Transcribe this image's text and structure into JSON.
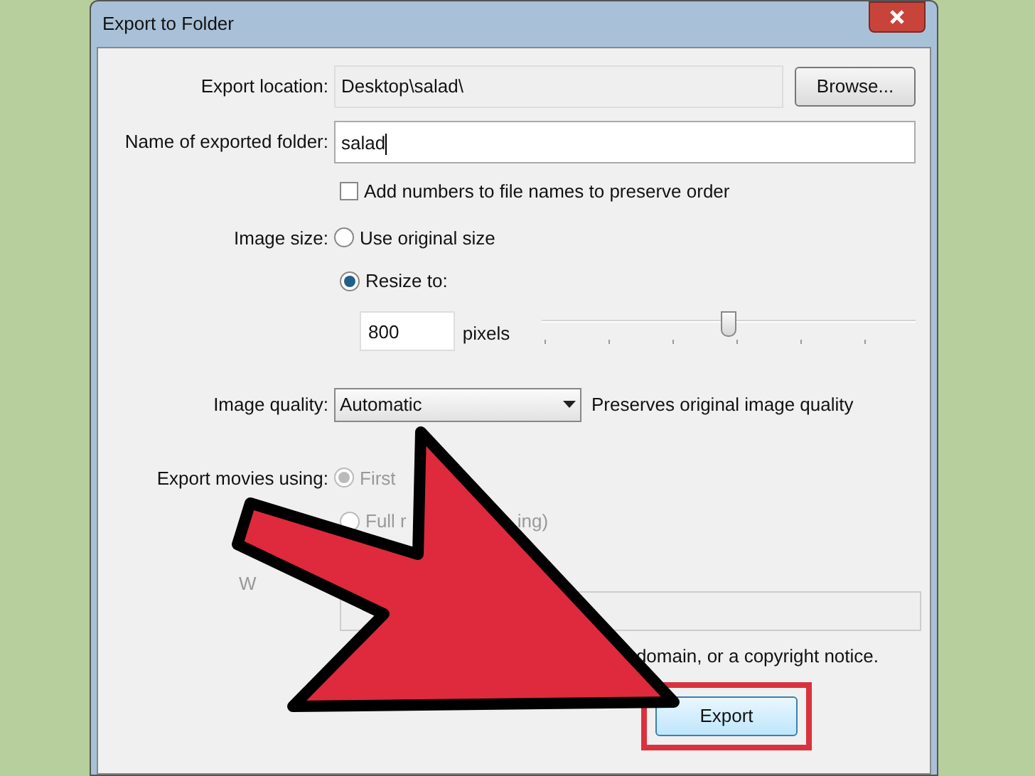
{
  "window": {
    "title": "Export to Folder"
  },
  "export_location": {
    "label": "Export location:",
    "value": "Desktop\\salad\\",
    "button": "Browse..."
  },
  "folder_name": {
    "label": "Name of exported folder:",
    "value": "salad"
  },
  "add_numbers": {
    "label": "Add numbers to file names to preserve order",
    "checked": false
  },
  "image_size": {
    "label": "Image size:",
    "options": [
      {
        "label": "Use original size",
        "selected": false
      },
      {
        "label": "Resize to:",
        "selected": true
      }
    ],
    "pixels_value": "800",
    "pixels_unit": "pixels",
    "level": 0.5
  },
  "image_quality": {
    "label": "Image quality:",
    "value": "Automatic",
    "note": "Preserves original image quality"
  },
  "export_movies": {
    "label": "Export movies using:",
    "options": [
      {
        "label": "First",
        "selected": true
      },
      {
        "label": "Full r",
        "tail": "ing)",
        "selected": false
      }
    ]
  },
  "watermark_row": {
    "label": "W",
    "note": "domain, or a copyright notice."
  },
  "buttons": [
    {
      "label": "Export",
      "highlighted": true
    }
  ]
}
